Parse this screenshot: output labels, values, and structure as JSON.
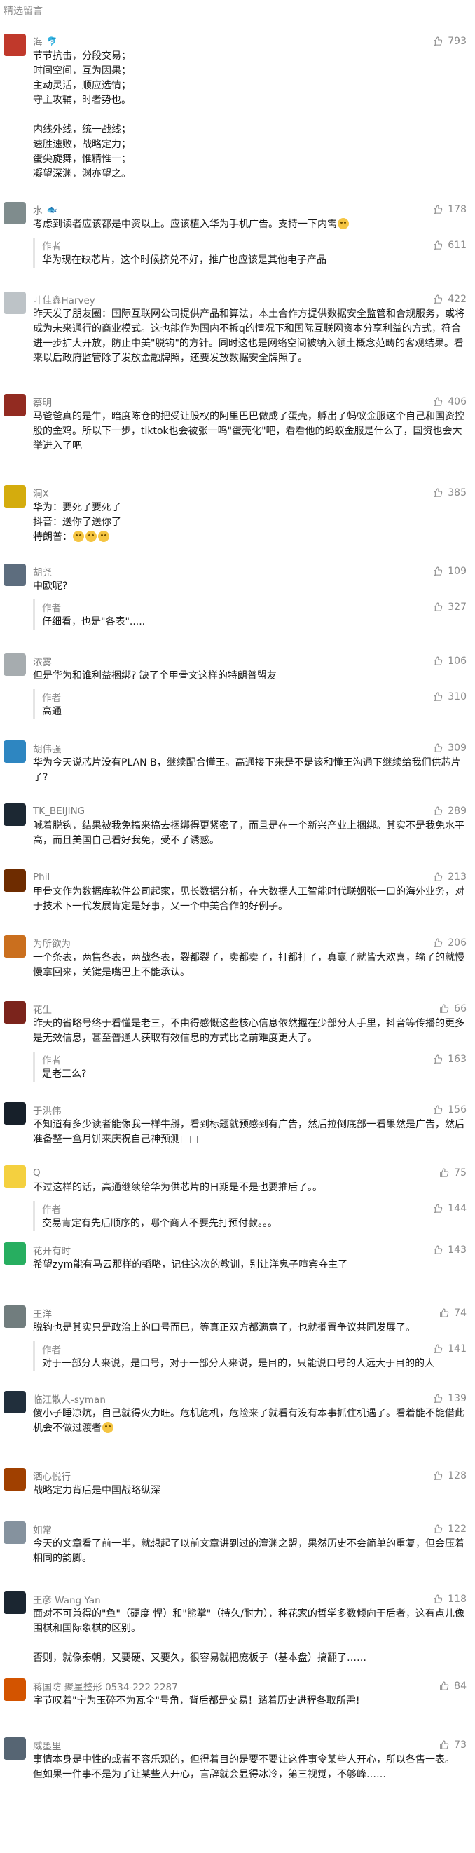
{
  "section_title": "精选留言",
  "comments": [
    {
      "name": "海",
      "tag": "🐬",
      "likes": "793",
      "avatar_color": "#c0392b",
      "text": "节节抗击，分段交易；\n时间空间，互为因果；\n主动灵活，顺应选情；\n守主攻辅，时者势也。\n\n内线外线，统一战线；\n速胜速败，战略定力；\n蛋尖旋舞，惟精惟一；\n凝望深渊，渊亦望之。",
      "replies": []
    },
    {
      "name": "水",
      "tag": "🐟",
      "likes": "178",
      "avatar_color": "#7f8c8d",
      "text": "考虑到读者应该都是中资以上。应该植入华为手机广告。支持一下内需",
      "emoji_after": "yellow",
      "replies": [
        {
          "name": "作者",
          "likes": "611",
          "text": "华为现在缺芯片，这个时候挤兑不好，推广也应该是其他电子产品"
        }
      ]
    },
    {
      "name": "叶佳鑫Harvey",
      "likes": "422",
      "avatar_color": "#bdc3c7",
      "text": "昨天发了朋友圈：国际互联网公司提供产品和算法，本土合作方提供数据安全监管和合规服务，或将成为未来通行的商业模式。这也能作为国内不拆q的情况下和国际互联网资本分享利益的方式，符合进一步扩大开放，防止中美\"脱钩\"的方针。同时这也是网络空间被纳入领土概念范畴的客观结果。看来以后政府监管除了发放金融牌照，还要发放数据安全牌照了。",
      "replies": []
    },
    {
      "name": "蔡明",
      "likes": "406",
      "avatar_color": "#922b21",
      "text": "马爸爸真的是牛，暗度陈仓的把受让股权的阿里巴巴做成了蛋壳，孵出了蚂蚁金服这个自己和国资控股的金鸡。所以下一步，tiktok也会被张一鸣\"蛋壳化\"吧，看看他的蚂蚁金服是什么了，国资也会大举进入了吧",
      "replies": []
    },
    {
      "name": "洞X",
      "likes": "385",
      "avatar_color": "#d4ac0d",
      "text": "华为：要死了要死了\n抖音：送你了送你了\n特朗普：",
      "replies": []
    },
    {
      "name": "胡尧",
      "likes": "109",
      "avatar_color": "#5d6d7e",
      "text": "中欧呢?",
      "replies": [
        {
          "name": "作者",
          "likes": "327",
          "text": "仔细看，也是\"各表\"....."
        }
      ]
    },
    {
      "name": "浓雾",
      "likes": "106",
      "avatar_color": "#a6acaf",
      "text": "但是华为和谁利益捆绑? 缺了个甲骨文这样的特朗普盟友",
      "replies": [
        {
          "name": "作者",
          "likes": "310",
          "text": "高通"
        }
      ]
    },
    {
      "name": "胡伟强",
      "likes": "309",
      "avatar_color": "#2e86c1",
      "text": "华为今天说芯片没有PLAN B，继续配合懂王。高通接下来是不是该和懂王沟通下继续给我们供芯片了?",
      "replies": []
    },
    {
      "name": "TK_BEIJING",
      "likes": "289",
      "avatar_color": "#1c2833",
      "text": "喊着脱钩，结果被我免搞来搞去捆绑得更紧密了，而且是在一个新兴产业上捆绑。其实不是我免水平高，而且美国自己看好我免，受不了诱惑。",
      "replies": []
    },
    {
      "name": "Phil",
      "likes": "213",
      "avatar_color": "#6e2c00",
      "text": "甲骨文作为数据库软件公司起家，见长数据分析，在大数据人工智能时代联姻张一口的海外业务，对于技术下一代发展肯定是好事，又一个中美合作的好例子。",
      "replies": []
    },
    {
      "name": "为所欲为",
      "likes": "206",
      "avatar_color": "#ca6f1e",
      "text": "一个条表，两售各表，两战各表，裂都裂了，卖都卖了，打都打了，真赢了就皆大欢喜，输了的就慢慢拿回来，关键是嘴巴上不能承认。",
      "replies": []
    },
    {
      "name": "花生",
      "likes": "66",
      "avatar_color": "#7b241c",
      "text": "昨天的省略号终于看懂是老三，不由得感慨这些核心信息依然握在少部分人手里，抖音等传播的更多是无效信息，甚至普通人获取有效信息的方式比之前难度更大了。",
      "replies": [
        {
          "name": "作者",
          "likes": "163",
          "text": "是老三么?"
        }
      ]
    },
    {
      "name": "于洪伟",
      "likes": "156",
      "avatar_color": "#17202a",
      "text": "不知道有多少读者能像我一样牛掰，看到标题就预感到有广告，然后拉倒底部一看果然是广告，然后准备整一盒月饼来庆祝自己神预测□□",
      "replies": []
    },
    {
      "name": "Q",
      "likes": "75",
      "avatar_color": "#f4d03f",
      "text": "不过这样的话，高通继续给华为供芯片的日期是不是也要推后了。。",
      "replies": [
        {
          "name": "作者",
          "likes": "144",
          "text": "交易肯定有先后顺序的，哪个商人不要先打预付款。。。"
        }
      ]
    },
    {
      "name": "花开有时",
      "likes": "143",
      "avatar_color": "#27ae60",
      "text": "希望zym能有马云那样的韬略，记住这次的教训，别让洋鬼子喧宾夺主了",
      "replies": []
    },
    {
      "name": "王洋",
      "likes": "74",
      "avatar_color": "#717d7e",
      "text": "脱钩也是其实只是政治上的口号而已，等真正双方都满意了，也就搁置争议共同发展了。",
      "replies": [
        {
          "name": "作者",
          "likes": "141",
          "text": "对于一部分人来说，是口号，对于一部分人来说，是目的，只能说口号的人远大于目的的人"
        }
      ]
    },
    {
      "name": "临江散人-syman",
      "likes": "139",
      "avatar_color": "#212f3c",
      "text": "傻小子睡凉炕，自己就得火力旺。危机危机，危险来了就看有没有本事抓住机遇了。看着能不能借此机会不做过渡者",
      "emoji_after": "yellow",
      "replies": []
    },
    {
      "name": "洒心悦行",
      "likes": "128",
      "avatar_color": "#a04000",
      "text": "战略定力背后是中国战略纵深",
      "replies": []
    },
    {
      "name": "如常",
      "likes": "122",
      "avatar_color": "#85929e",
      "text": "今天的文章看了前一半，就想起了以前文章讲到过的澶渊之盟，果然历史不会简单的重复，但会压着相同的韵脚。",
      "replies": []
    },
    {
      "name": "王彦 Wang Yan",
      "likes": "118",
      "avatar_color": "#1b2631",
      "text": "面对不可兼得的\"鱼\"（硬度 悍）和\"熊掌\"（持久/耐力），种花家的哲学多数倾向于后者，这有点儿像围棋和国际象棋的区别。\n\n否则，就像秦朝，又要硬、又要久，很容易就把庞板子（基本盘）搞翻了……",
      "replies": []
    },
    {
      "name": "蒋国防 聚星整形 0534-222 2287",
      "likes": "84",
      "avatar_color": "#d35400",
      "text": "字节叹着\"宁为玉碎不为瓦全\"号角，背后都是交易！踏着历史进程各取所需!",
      "replies": []
    },
    {
      "name": "威墨里",
      "likes": "73",
      "avatar_color": "#566573",
      "text": "事情本身是中性的或者不容乐观的，但得着目的是要不要让这件事令某些人开心，所以各售一表。\n但如果一件事不是为了让某些人开心，言辞就会显得冰冷，第三视觉，不够峰……",
      "replies": []
    }
  ]
}
